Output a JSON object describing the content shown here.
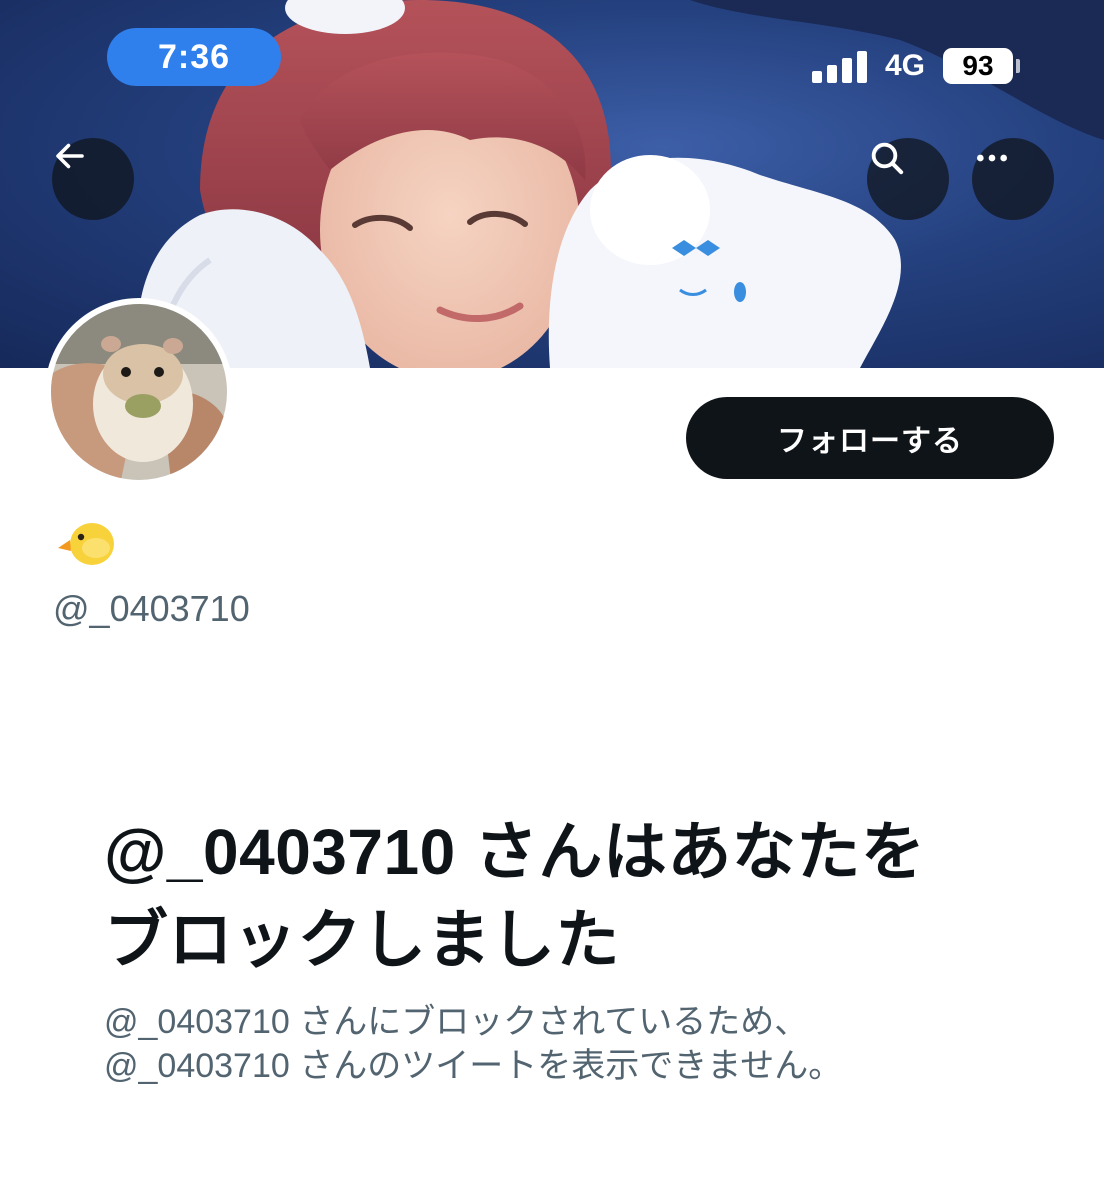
{
  "status_bar": {
    "time": "7:36",
    "network": "4G",
    "battery": "93"
  },
  "header": {
    "back_icon": "arrow-left-icon",
    "search_icon": "search-icon",
    "more_icon": "more-horizontal-icon"
  },
  "profile": {
    "display_name_emoji": "🐤",
    "handle": "@_0403710",
    "follow_label": "フォローする"
  },
  "blocked": {
    "title": "@_0403710 さんはあなたをブロックしました",
    "description_line1": "@_0403710 さんにブロックされているため、",
    "description_line2": "@_0403710 さんのツイートを表示できません。"
  },
  "colors": {
    "accent_pill": "#2f80ed",
    "follow_button_bg": "#0f1419",
    "secondary_text": "#536471",
    "banner_bg": "#24407e"
  }
}
